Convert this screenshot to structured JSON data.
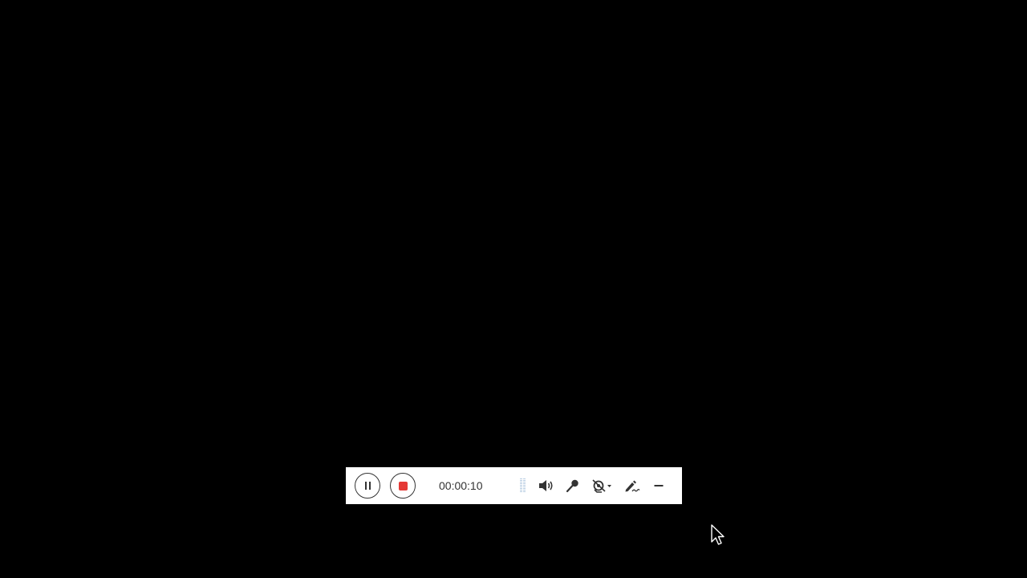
{
  "toolbar": {
    "timer": "00:00:10",
    "stop_color": "#e53935",
    "icons": {
      "pause": "pause-icon",
      "stop": "stop-icon",
      "level": "audio-level-icon",
      "speaker": "speaker-icon",
      "microphone": "microphone-icon",
      "camera": "camera-off-icon",
      "annotate": "pen-icon",
      "minimize": "minimize-icon"
    }
  }
}
